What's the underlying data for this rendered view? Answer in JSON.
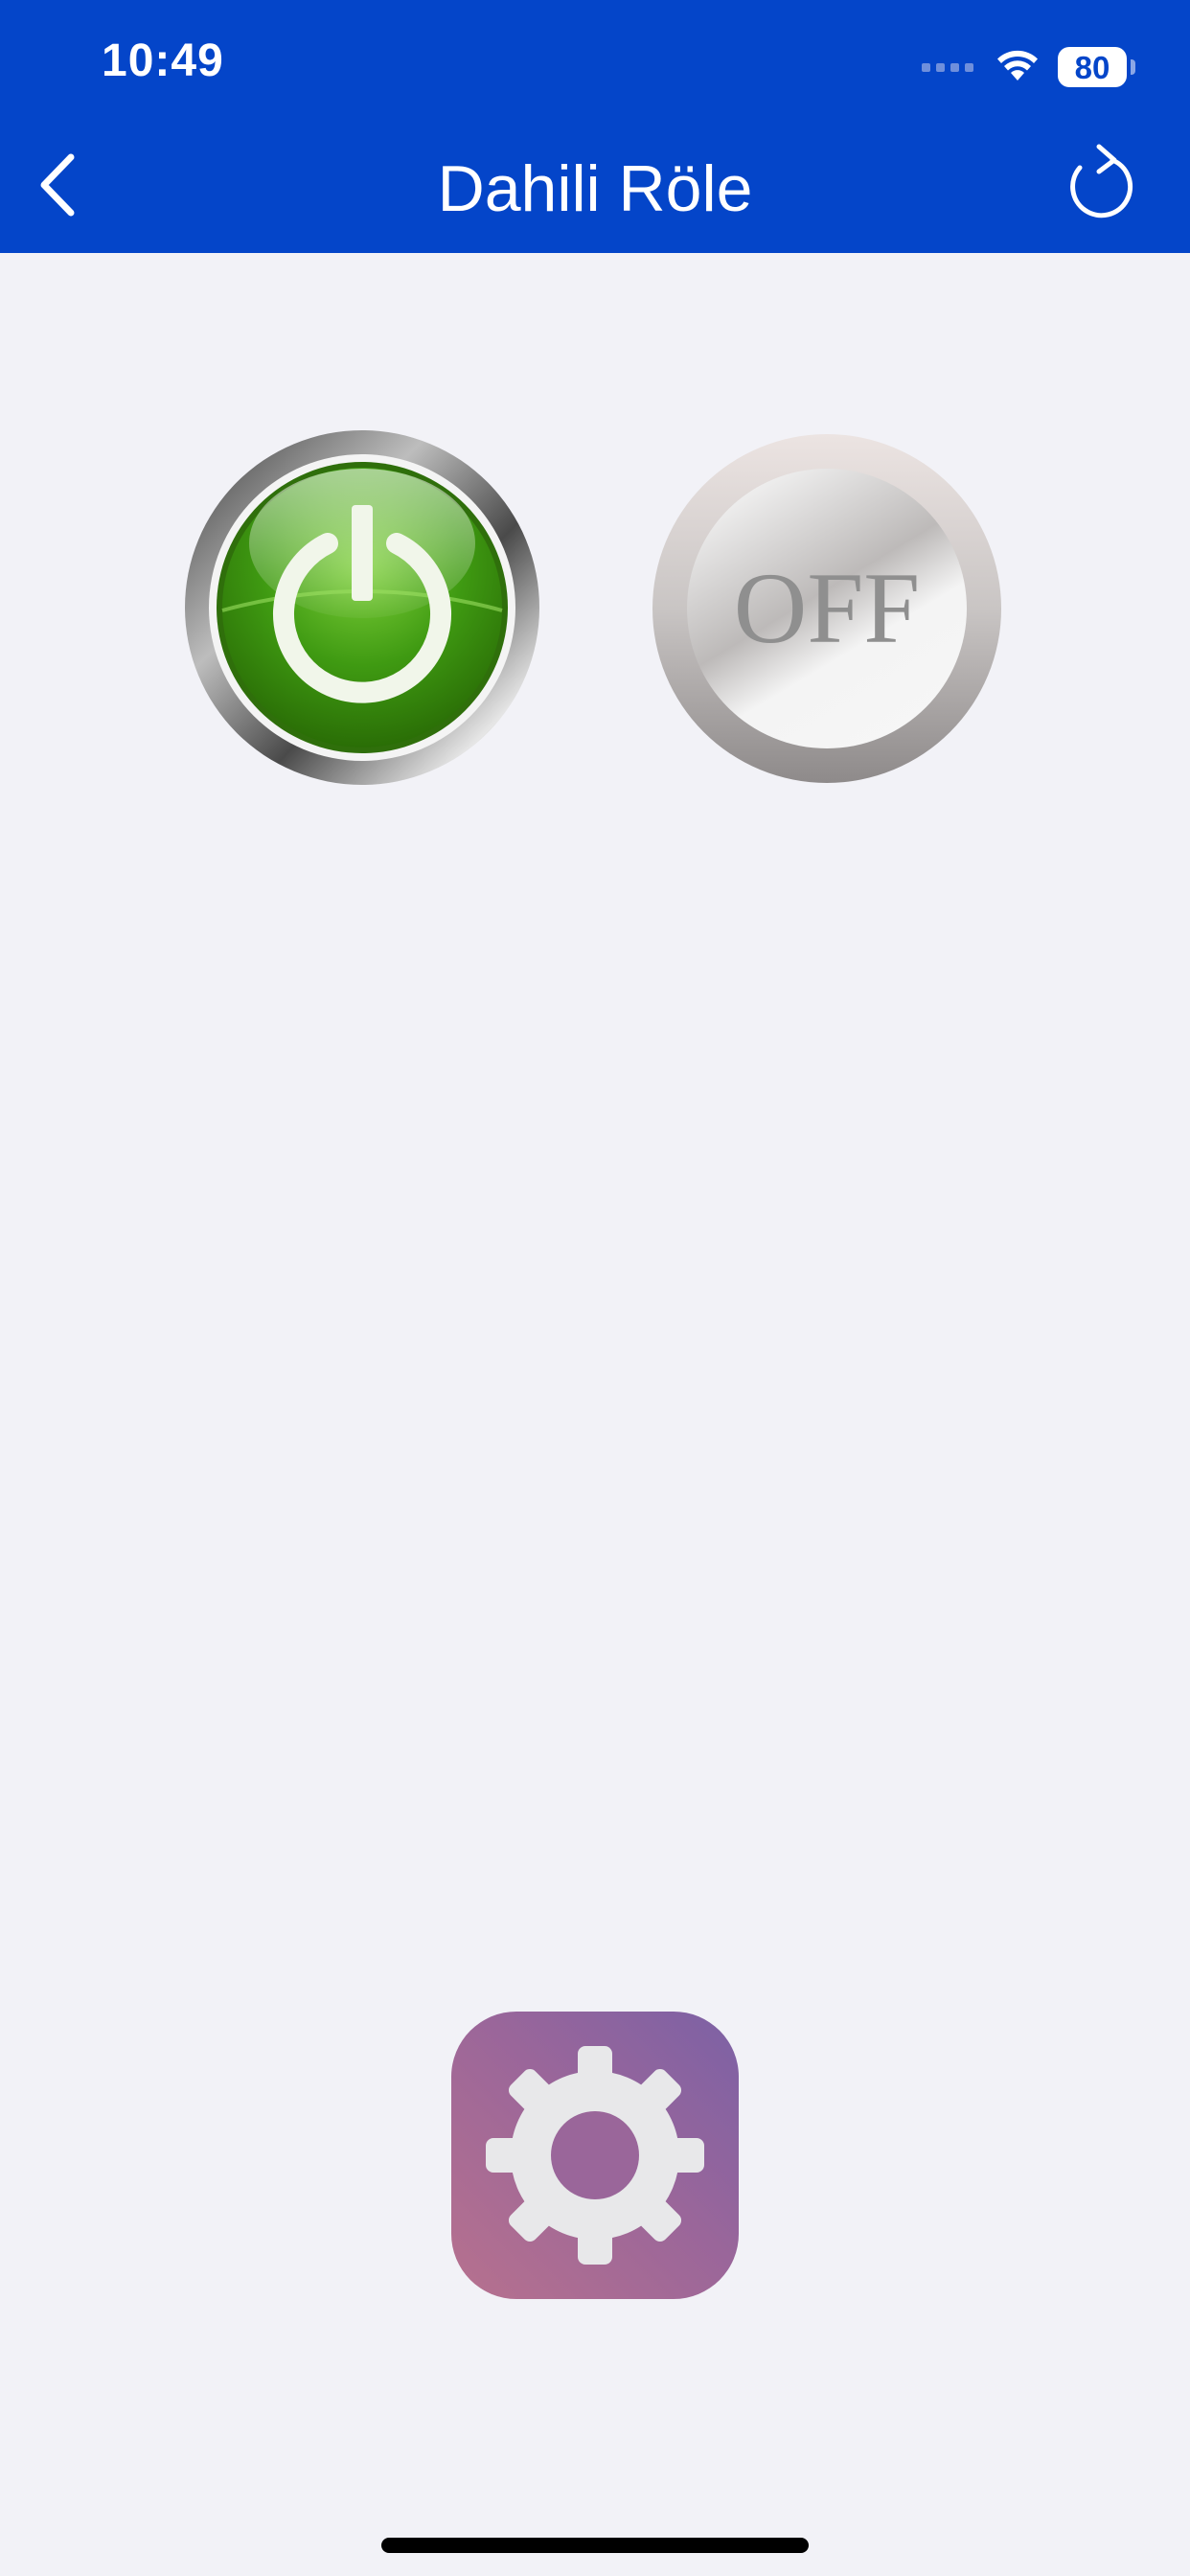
{
  "status_bar": {
    "time": "10:49",
    "battery": "80",
    "icons": [
      "signal-dots-icon",
      "wifi-icon",
      "battery-icon"
    ]
  },
  "nav": {
    "title": "Dahili Röle",
    "back_icon": "chevron-left-icon",
    "refresh_icon": "refresh-icon"
  },
  "relays": {
    "on_button_icon": "power-icon",
    "off_label": "OFF"
  },
  "settings": {
    "icon": "gear-icon"
  },
  "colors": {
    "nav_background": "#0445c9",
    "page_background": "#f2f2f7",
    "on_green": "#3a8d0a",
    "settings_gradient_start": "#b7718e",
    "settings_gradient_end": "#7c61a5"
  }
}
